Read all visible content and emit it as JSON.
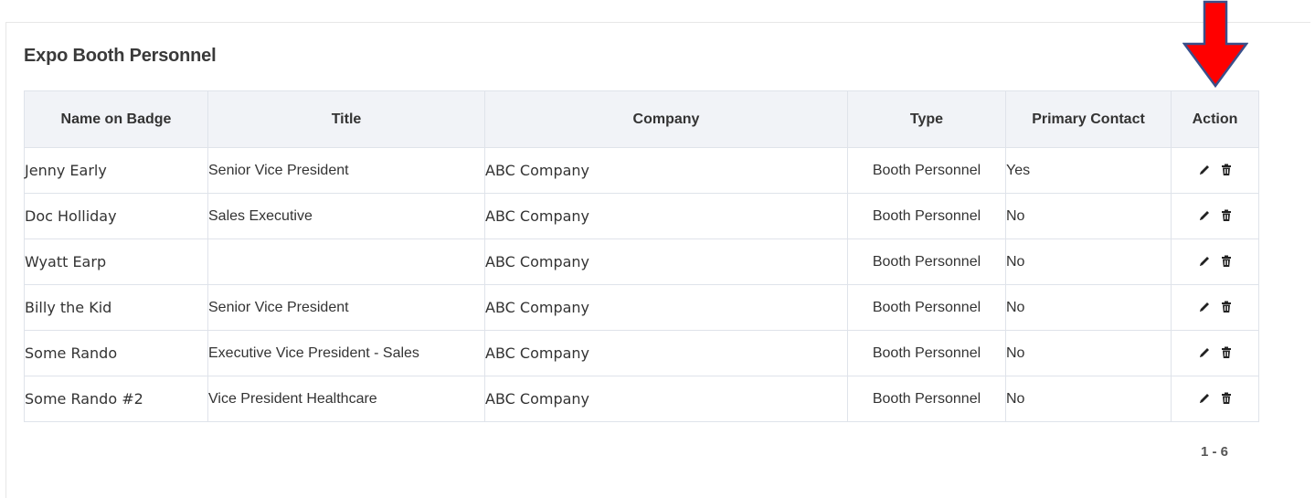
{
  "panel": {
    "title": "Expo Booth Personnel"
  },
  "table": {
    "headers": [
      "Name on Badge",
      "Title",
      "Company",
      "Type",
      "Primary Contact",
      "Action"
    ],
    "rows": [
      {
        "name": "Jenny Early",
        "title": "Senior Vice President",
        "company": "ABC Company",
        "type": "Booth Personnel",
        "primary": "Yes"
      },
      {
        "name": "Doc Holliday",
        "title": "Sales Executive",
        "company": "ABC Company",
        "type": "Booth Personnel",
        "primary": "No"
      },
      {
        "name": "Wyatt Earp",
        "title": "",
        "company": "ABC Company",
        "type": "Booth Personnel",
        "primary": "No"
      },
      {
        "name": "Billy the Kid",
        "title": "Senior Vice President",
        "company": "ABC Company",
        "type": "Booth Personnel",
        "primary": "No"
      },
      {
        "name": "Some Rando",
        "title": "Executive Vice President - Sales",
        "company": "ABC Company",
        "type": "Booth Personnel",
        "primary": "No"
      },
      {
        "name": "Some Rando #2",
        "title": "Vice President Healthcare",
        "company": "ABC Company",
        "type": "Booth Personnel",
        "primary": "No"
      }
    ],
    "row_actions": [
      "edit-icon",
      "trash-icon"
    ]
  },
  "pager": {
    "range": "1 - 6"
  },
  "annotation": {
    "arrow_color": "#ff0000",
    "arrow_outline": "#3a4f8a"
  }
}
